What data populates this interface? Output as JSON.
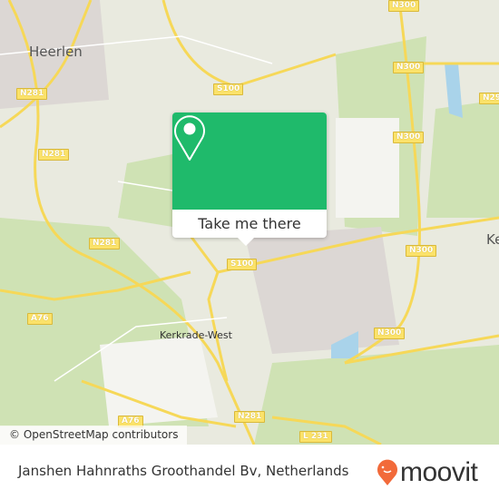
{
  "map": {
    "city_labels": [
      "Heerlen",
      "Kerkrade-West",
      "Ke"
    ],
    "road_shields": [
      "N300",
      "N300",
      "N300",
      "N300",
      "N300",
      "S100",
      "S100",
      "N281",
      "N281",
      "N281",
      "N281",
      "A76",
      "A76",
      "L 231",
      "N29"
    ],
    "attribution": "© OpenStreetMap contributors"
  },
  "popup": {
    "icon": "map-pin-icon",
    "button_label": "Take me there",
    "color": "#1fba6b"
  },
  "footer": {
    "place_name": "Janshen Hahnraths Groothandel Bv, Netherlands",
    "logo_text": "moovit",
    "logo_color": "#f26a3a"
  }
}
